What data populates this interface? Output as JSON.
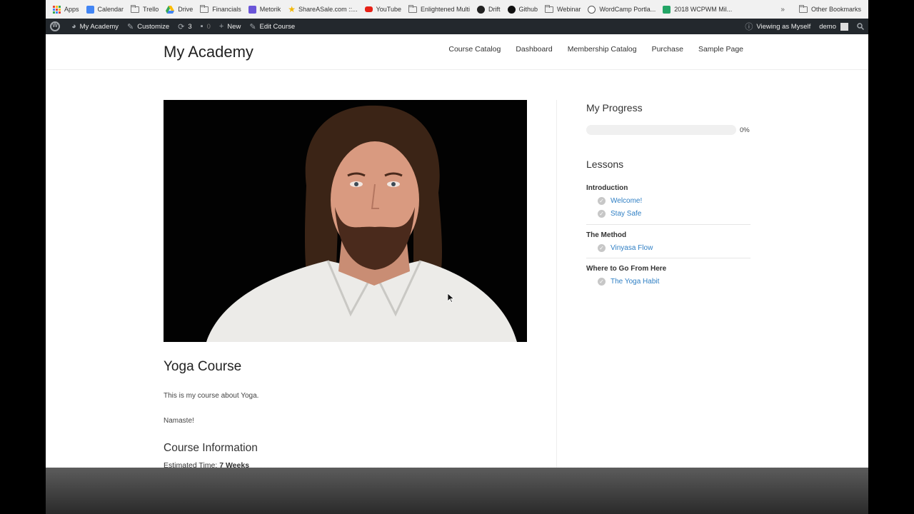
{
  "bookmarks": {
    "items": [
      {
        "label": "Apps",
        "icon": "apps-grid-icon"
      },
      {
        "label": "Calendar",
        "icon": "calendar-icon"
      },
      {
        "label": "Trello",
        "icon": "folder-icon"
      },
      {
        "label": "Drive",
        "icon": "drive-icon"
      },
      {
        "label": "Financials",
        "icon": "folder-icon"
      },
      {
        "label": "Metorik",
        "icon": "metorik-icon"
      },
      {
        "label": "ShareASale.com ::...",
        "icon": "star-icon"
      },
      {
        "label": "YouTube",
        "icon": "youtube-icon"
      },
      {
        "label": "Enlightened Multi",
        "icon": "folder-icon"
      },
      {
        "label": "Drift",
        "icon": "drift-icon"
      },
      {
        "label": "Github",
        "icon": "github-icon"
      },
      {
        "label": "Webinar",
        "icon": "folder-icon"
      },
      {
        "label": "WordCamp Portla...",
        "icon": "wordpress-icon"
      },
      {
        "label": "2018 WCPWM Mil...",
        "icon": "sheets-icon"
      }
    ],
    "more": "»",
    "other": "Other Bookmarks"
  },
  "adminbar": {
    "site": "My Academy",
    "customize": "Customize",
    "updates": "3",
    "comments": "0",
    "new": "New",
    "edit": "Edit Course",
    "viewing": "Viewing as Myself",
    "user": "demo"
  },
  "site": {
    "title": "My Academy",
    "nav": [
      "Course Catalog",
      "Dashboard",
      "Membership Catalog",
      "Purchase",
      "Sample Page"
    ]
  },
  "course": {
    "title": "Yoga Course",
    "para1": "This is my course about Yoga.",
    "para2": "Namaste!",
    "info_title": "Course Information",
    "est_label": "Estimated Time:",
    "est_value": "7 Weeks"
  },
  "sidebar": {
    "progress_title": "My Progress",
    "progress_value": 0,
    "progress_label": "0%",
    "lessons_title": "Lessons",
    "sections": [
      {
        "title": "Introduction",
        "lessons": [
          "Welcome!",
          "Stay Safe"
        ]
      },
      {
        "title": "The Method",
        "lessons": [
          "Vinyasa Flow"
        ]
      },
      {
        "title": "Where to Go From Here",
        "lessons": [
          "The Yoga Habit"
        ]
      }
    ]
  },
  "colors": {
    "admin_bar": "#23282d",
    "link": "#2f7fc4",
    "check": "#c7c7c7"
  }
}
